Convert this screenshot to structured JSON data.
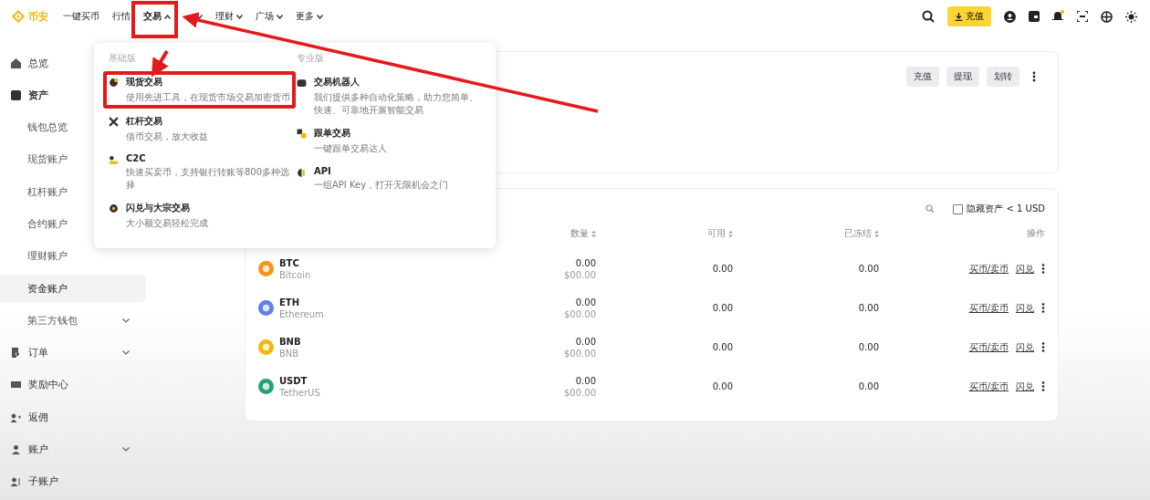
{
  "topbar": {
    "logo": "币安",
    "nav": [
      {
        "label": "一键买币",
        "caret": false,
        "expanded": false
      },
      {
        "label": "行情",
        "caret": false,
        "expanded": false
      },
      {
        "label": "交易",
        "caret": true,
        "expanded": true
      },
      {
        "caret": true,
        "expanded": false
      },
      {
        "label": "理财",
        "caret": true,
        "expanded": false
      },
      {
        "label": "广场",
        "caret": true,
        "expanded": false
      },
      {
        "label": "更多",
        "caret": true,
        "expanded": false
      }
    ],
    "deposit_button": "充值"
  },
  "dropdown": {
    "columns": [
      {
        "heading": "基础版",
        "items": [
          {
            "title": "现货交易",
            "desc": "使用先进工具，在现货市场交易加密货币"
          },
          {
            "title": "杠杆交易",
            "desc": "借币交易，放大收益"
          },
          {
            "title": "C2C",
            "desc": "快速买卖币，支持银行转账等800多种选择"
          },
          {
            "title": "闪兑与大宗交易",
            "desc": "大小额交易轻松完成"
          }
        ]
      },
      {
        "heading": "专业版",
        "items": [
          {
            "title": "交易机器人",
            "desc": "我们提供多种自动化策略，助力您简单、快速、可靠地开展智能交易"
          },
          {
            "title": "跟单交易",
            "desc": "一键跟单交易达人"
          },
          {
            "title": "API",
            "desc": "一组API Key，打开无限机会之门"
          }
        ]
      }
    ]
  },
  "sidebar": {
    "items": [
      {
        "label": "总览",
        "selected": false
      },
      {
        "label": "资产",
        "selected": false,
        "children": [
          {
            "label": "钱包总览",
            "selected": false
          },
          {
            "label": "现货账户",
            "selected": false
          },
          {
            "label": "杠杆账户",
            "selected": false
          },
          {
            "label": "合约账户",
            "selected": false
          },
          {
            "label": "理财账户",
            "selected": false
          },
          {
            "label": "资金账户",
            "selected": true
          },
          {
            "label": "第三方钱包",
            "chevron": true,
            "selected": false
          }
        ]
      },
      {
        "label": "订单",
        "chevron": true,
        "selected": false
      },
      {
        "label": "奖励中心",
        "selected": false
      },
      {
        "label": "返佣",
        "selected": false
      },
      {
        "label": "账户",
        "chevron": true,
        "selected": false
      },
      {
        "label": "子账户",
        "selected": false
      }
    ]
  },
  "actions": [
    "充值",
    "提现",
    "划转"
  ],
  "assets": {
    "hide_small": {
      "label": "隐藏资产 < 1 USD",
      "checked": false
    },
    "columns": [
      "数量",
      "可用",
      "已冻结",
      "操作"
    ],
    "rows": [
      {
        "symbol": "BTC",
        "name": "Bitcoin",
        "color": "#f7931a",
        "amount": "0.00",
        "value": "$00.00",
        "available": "0.00",
        "frozen": "0.00",
        "buy": "买币/卖币",
        "convert": "闪兑"
      },
      {
        "symbol": "ETH",
        "name": "Ethereum",
        "color": "#627eea",
        "amount": "0.00",
        "value": "$00.00",
        "available": "0.00",
        "frozen": "0.00",
        "buy": "买币/卖币",
        "convert": "闪兑"
      },
      {
        "symbol": "BNB",
        "name": "BNB",
        "color": "#f0b90b",
        "amount": "0.00",
        "value": "$00.00",
        "available": "0.00",
        "frozen": "0.00",
        "buy": "买币/卖币",
        "convert": "闪兑"
      },
      {
        "symbol": "USDT",
        "name": "TetherUS",
        "color": "#26a17b",
        "amount": "0.00",
        "value": "$00.00",
        "available": "0.00",
        "frozen": "0.00",
        "buy": "买币/卖币",
        "convert": "闪兑"
      }
    ]
  }
}
